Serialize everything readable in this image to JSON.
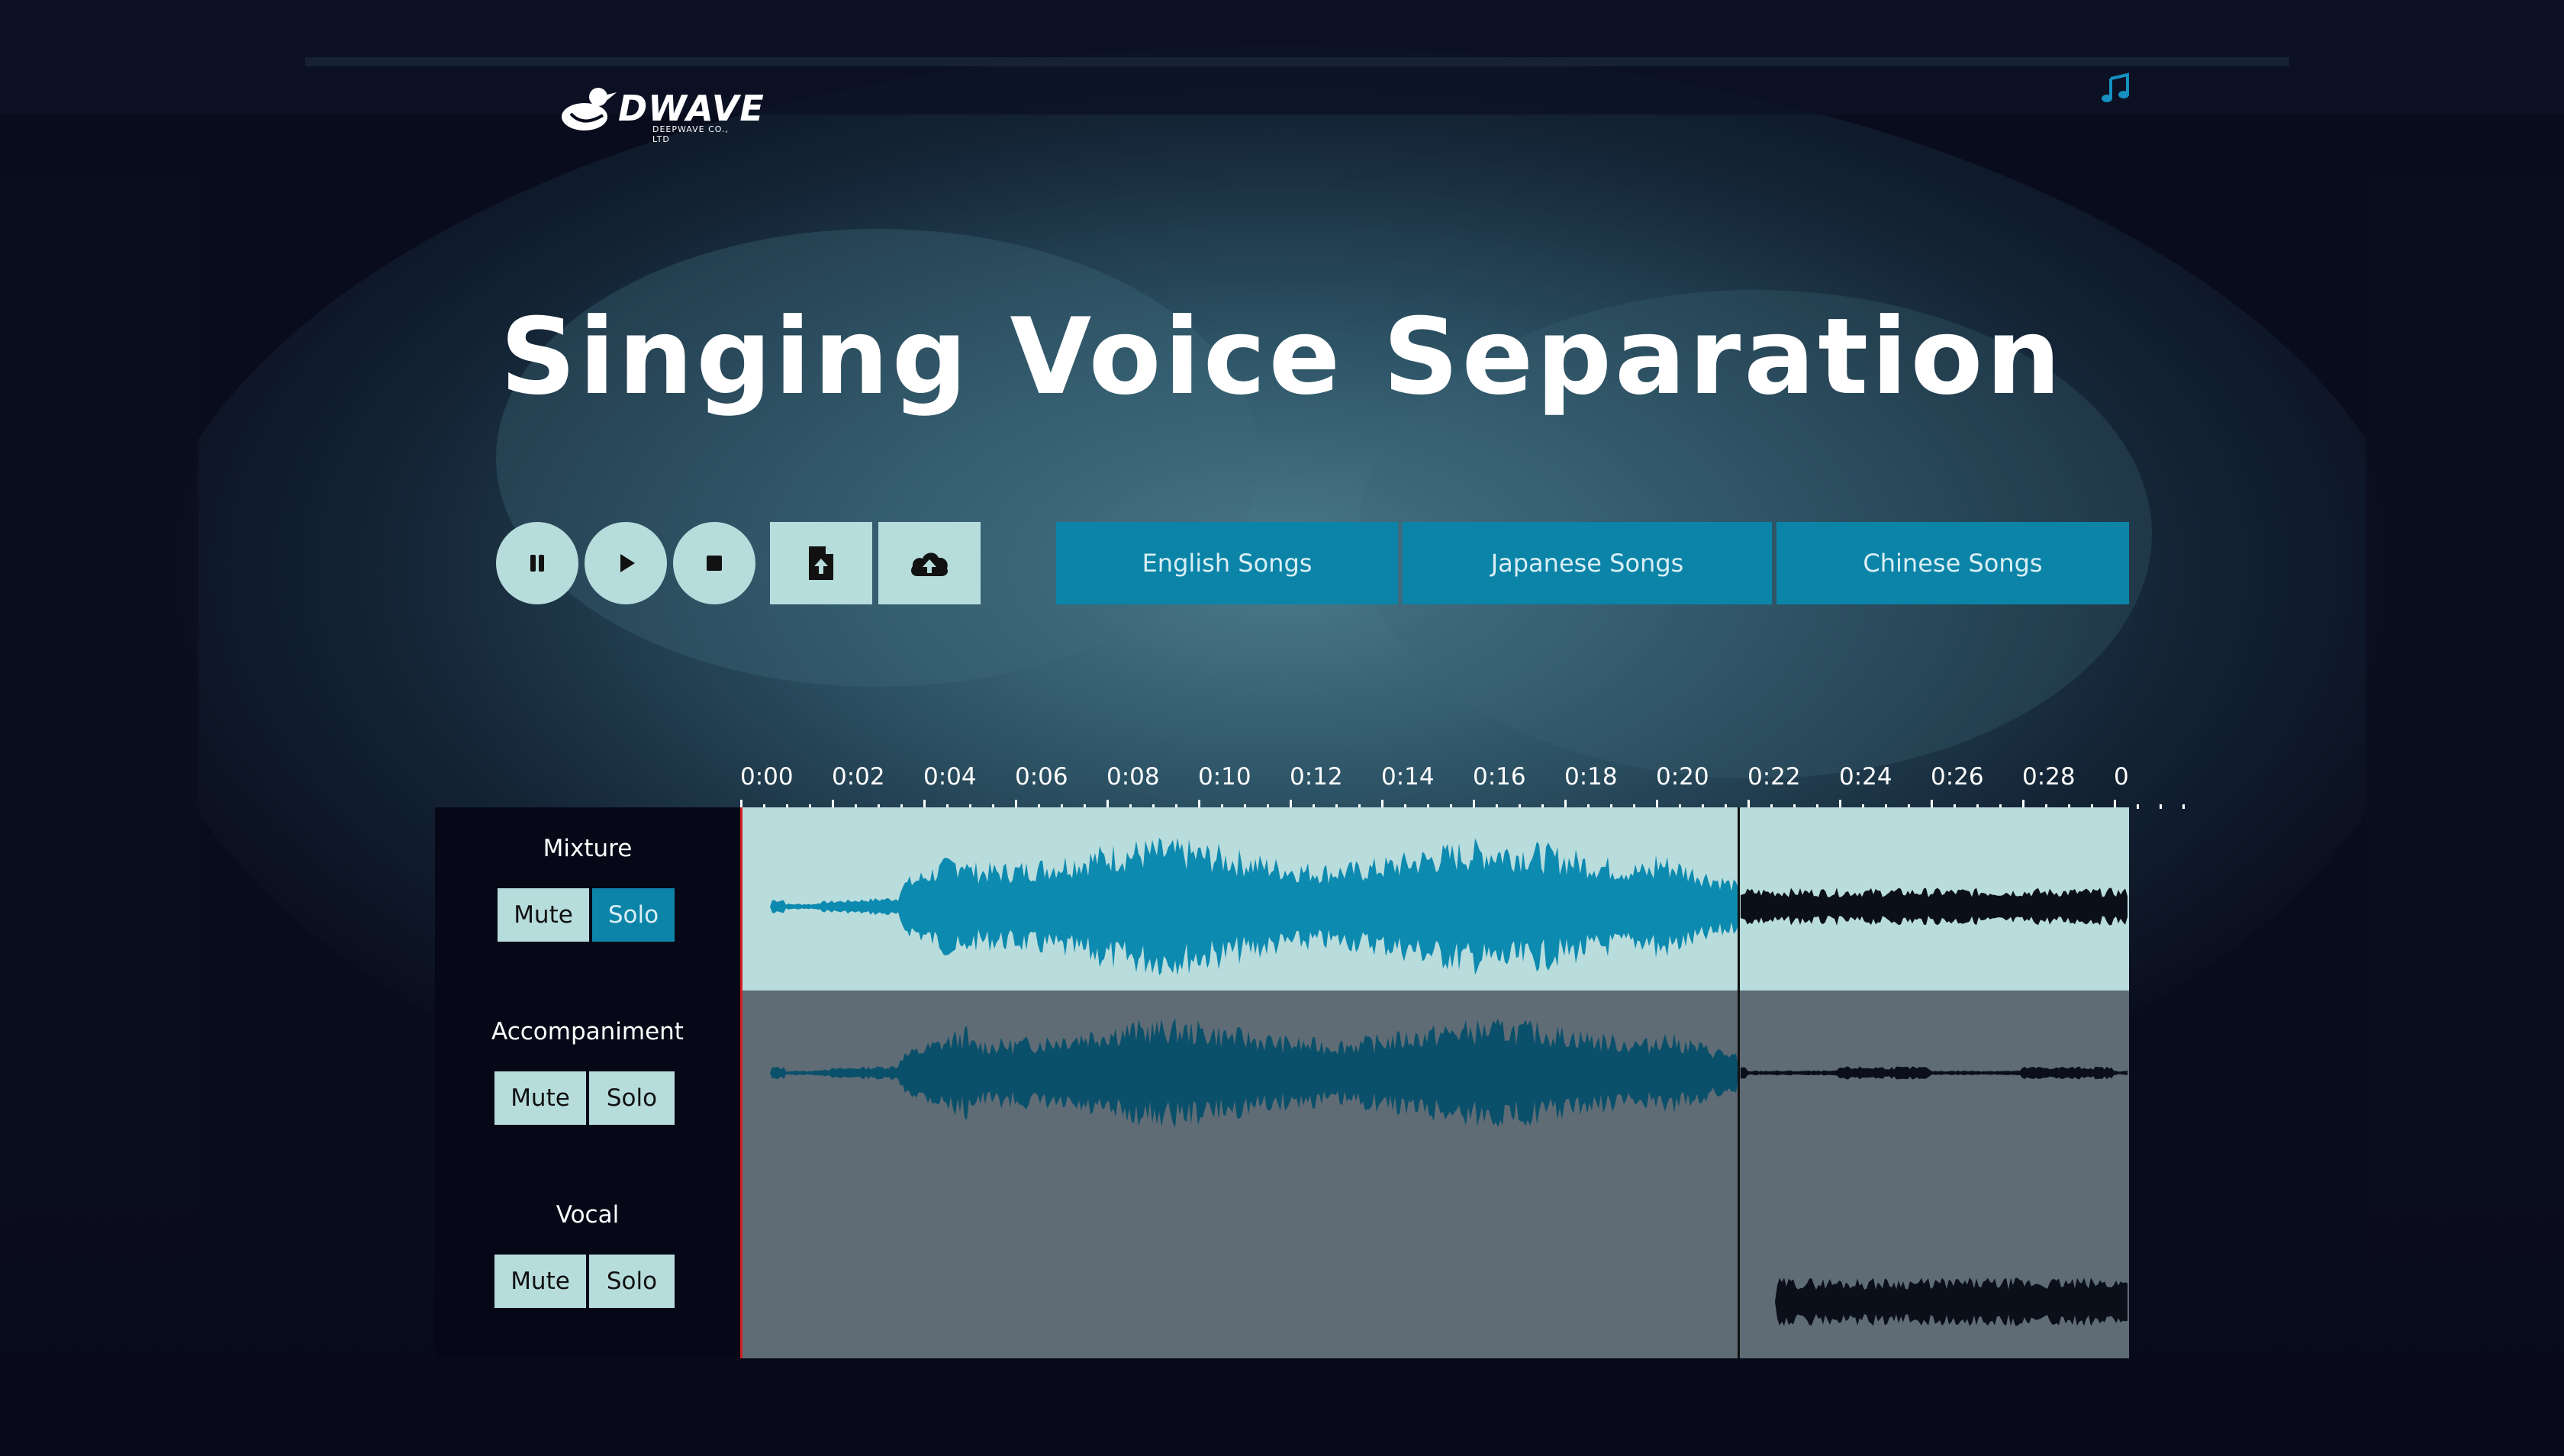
{
  "header": {
    "logo_word": "DWAVE",
    "logo_sub": "DEEPWAVE CO., LTD",
    "title": "Singing Voice Separation"
  },
  "icons": {
    "logo": "duck-logo-icon",
    "music": "music-note-icon",
    "pause": "pause-icon",
    "play": "play-icon",
    "stop": "stop-icon",
    "upload_file": "file-upload-icon",
    "cloud_upload": "cloud-upload-icon"
  },
  "song_tabs": [
    "English Songs",
    "Japanese Songs",
    "Chinese Songs"
  ],
  "timeline": {
    "ticks": [
      "0:00",
      "0:02",
      "0:04",
      "0:06",
      "0:08",
      "0:10",
      "0:12",
      "0:14",
      "0:16",
      "0:18",
      "0:20",
      "0:22",
      "0:24",
      "0:26",
      "0:28",
      "0"
    ]
  },
  "tracks": [
    {
      "name": "Mixture",
      "mute": "Mute",
      "solo": "Solo",
      "solo_active": true
    },
    {
      "name": "Accompaniment",
      "mute": "Mute",
      "solo": "Solo",
      "solo_active": false
    },
    {
      "name": "Vocal",
      "mute": "Mute",
      "solo": "Solo",
      "solo_active": false
    }
  ],
  "playback": {
    "position_seconds": 21.8
  },
  "colors": {
    "accent": "#0c84a8",
    "button_bg": "#b7dcdc",
    "page_bg": "#090c1c",
    "mixture_lane": "#b9dcdc",
    "other_lanes": "#5f6c76",
    "wave_progress_mix": "#0c8ab0",
    "wave_progress_acc": "#0a506a",
    "wave_remaining": "#0b0f1a"
  }
}
